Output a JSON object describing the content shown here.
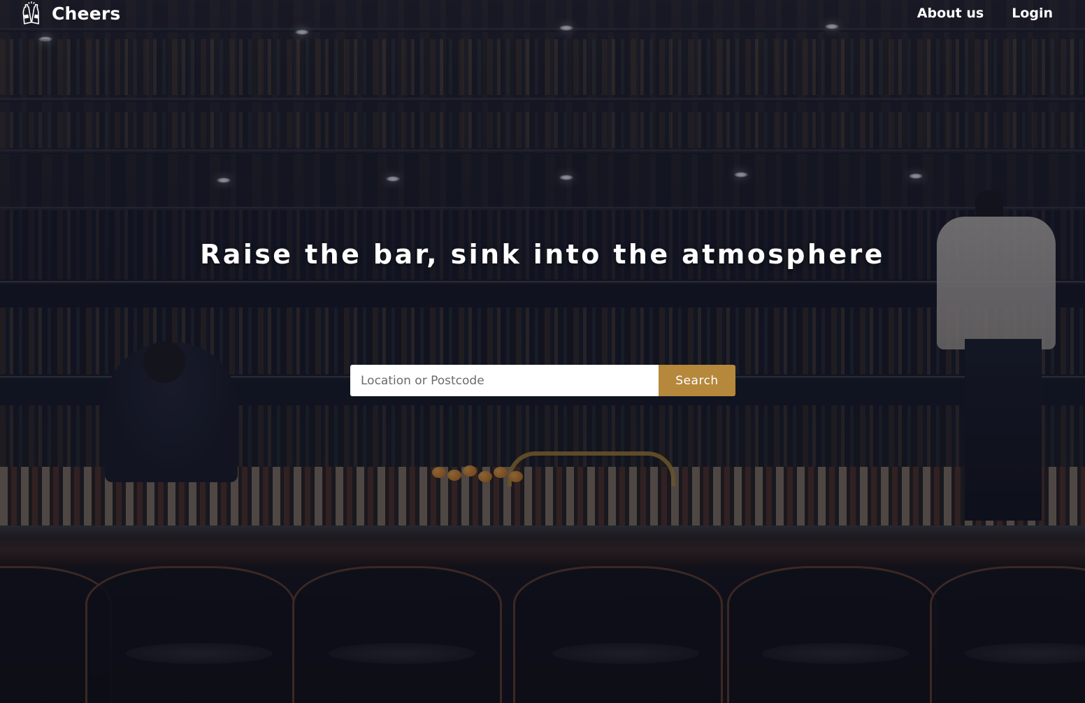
{
  "header": {
    "brand_name": "Cheers",
    "brand_icon": "beer-bottles-icon",
    "nav": {
      "about_label": "About us",
      "login_label": "Login"
    }
  },
  "hero": {
    "title": "Raise the bar, sink into the atmosphere",
    "background": "bar-interior-photo"
  },
  "search": {
    "placeholder": "Location or Postcode",
    "value": "",
    "button_label": "Search"
  },
  "colors": {
    "accent": "#b5883c",
    "text": "#ffffff",
    "overlay": "#0a0c16"
  }
}
